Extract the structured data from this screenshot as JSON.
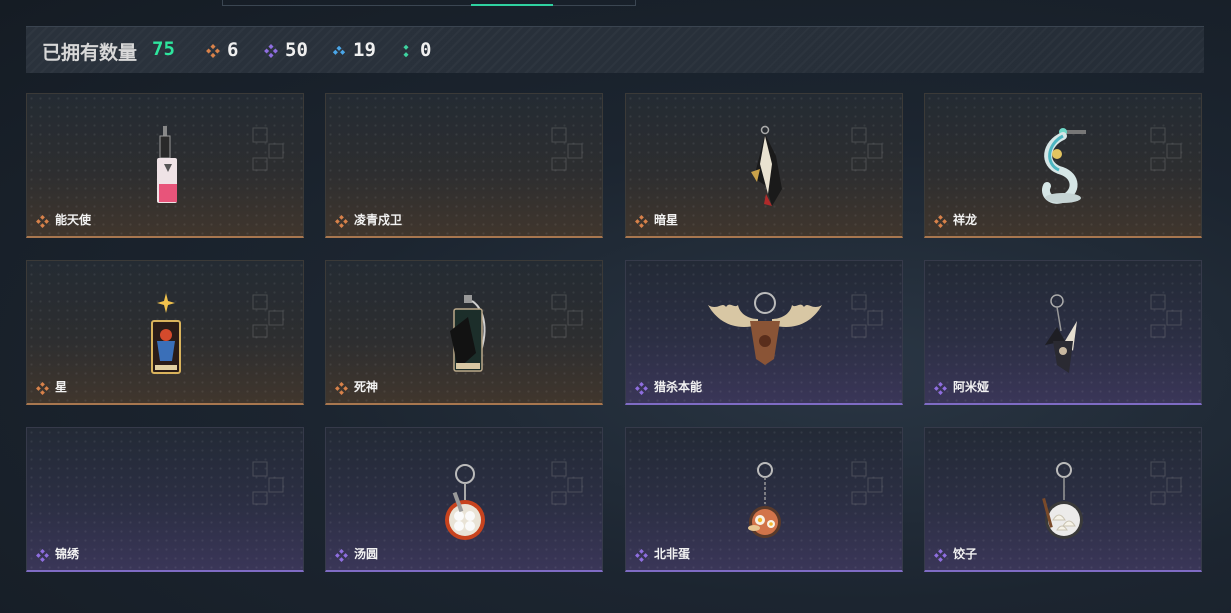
{
  "header": {
    "title": "",
    "search_value": ""
  },
  "summary": {
    "label": "已拥有数量",
    "total": "75",
    "rarities": [
      {
        "name": "orange",
        "icon": "orange-diamond-icon",
        "color": "#d9824a",
        "count": "6"
      },
      {
        "name": "purple",
        "icon": "purple-diamond-icon",
        "color": "#8f6ee0",
        "count": "50"
      },
      {
        "name": "blue",
        "icon": "blue-chevron-icon",
        "color": "#4aa6e8",
        "count": "19"
      },
      {
        "name": "green",
        "icon": "green-dots-icon",
        "color": "#3ed4a0",
        "count": "0"
      }
    ]
  },
  "items": [
    {
      "name": "能天使",
      "rarity": "orange",
      "icon": "charm-energy-angel"
    },
    {
      "name": "凌青戍卫",
      "rarity": "orange",
      "icon": ""
    },
    {
      "name": "暗星",
      "rarity": "orange",
      "icon": "charm-dark-star"
    },
    {
      "name": "祥龙",
      "rarity": "orange",
      "icon": "charm-dragon"
    },
    {
      "name": "星",
      "rarity": "orange",
      "icon": "charm-star-card"
    },
    {
      "name": "死神",
      "rarity": "orange",
      "icon": "charm-reaper-card"
    },
    {
      "name": "猎杀本能",
      "rarity": "purple",
      "icon": "charm-moose-antlers"
    },
    {
      "name": "阿米娅",
      "rarity": "purple",
      "icon": "charm-amiya"
    },
    {
      "name": "锦绣",
      "rarity": "purple",
      "icon": ""
    },
    {
      "name": "汤圆",
      "rarity": "purple",
      "icon": "charm-tangyuan-bowl"
    },
    {
      "name": "北非蛋",
      "rarity": "purple",
      "icon": "charm-shakshuka"
    },
    {
      "name": "饺子",
      "rarity": "purple",
      "icon": "charm-dumplings"
    }
  ]
}
